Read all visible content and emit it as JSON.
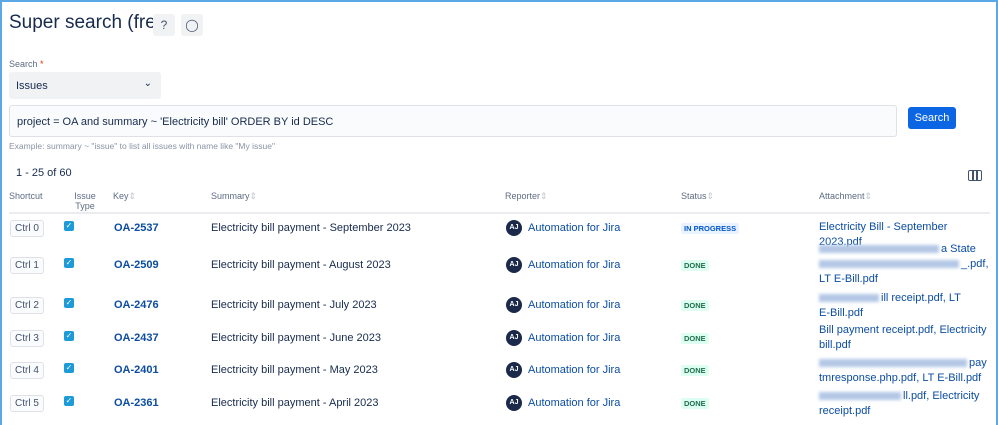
{
  "header": {
    "title": "Super search (free)",
    "help_icon": "?",
    "idea_icon": "lightbulb"
  },
  "search": {
    "label": "Search",
    "required": "*",
    "type": "Issues",
    "query": "project = OA and summary ~ 'Electricity bill' ORDER BY id DESC",
    "button": "Search",
    "hint": "Example: summary ~ \"issue\" to list all issues with name like \"My issue\""
  },
  "results": {
    "count": "1 - 25 of 60"
  },
  "columns": {
    "shortcut": "Shortcut",
    "type": "Issue Type",
    "key": "Key",
    "summary": "Summary",
    "reporter": "Reporter",
    "status": "Status",
    "attachment": "Attachment"
  },
  "rows": [
    {
      "shortcut": "Ctrl 0",
      "key": "OA-2537",
      "summary": "Electricity bill payment - September 2023",
      "initials": "AJ",
      "reporter": "Automation for Jira",
      "status": "IN PROGRESS",
      "attachment": "Electricity Bill - September 2023.pdf"
    },
    {
      "shortcut": "Ctrl 1",
      "key": "OA-2509",
      "summary": "Electricity bill payment - August 2023",
      "initials": "AJ",
      "reporter": "Automation for Jira",
      "status": "DONE",
      "attachment_a": "a State",
      "attachment_b": "_.pdf,",
      "attachment": "LT E-Bill.pdf"
    },
    {
      "shortcut": "Ctrl 2",
      "key": "OA-2476",
      "summary": "Electricity bill payment - July 2023",
      "initials": "AJ",
      "reporter": "Automation for Jira",
      "status": "DONE",
      "attachment_a": "ill receipt.pdf, LT",
      "attachment": "E-Bill.pdf"
    },
    {
      "shortcut": "Ctrl 3",
      "key": "OA-2437",
      "summary": "Electricity bill payment - June 2023",
      "initials": "AJ",
      "reporter": "Automation for Jira",
      "status": "DONE",
      "attachment_a": "Bill payment receipt.pdf, Electricity",
      "attachment": "bill.pdf"
    },
    {
      "shortcut": "Ctrl 4",
      "key": "OA-2401",
      "summary": "Electricity bill payment - May 2023",
      "initials": "AJ",
      "reporter": "Automation for Jira",
      "status": "DONE",
      "attachment_a": "pay",
      "attachment": "tmresponse.php.pdf, LT E-Bill.pdf"
    },
    {
      "shortcut": "Ctrl 5",
      "key": "OA-2361",
      "summary": "Electricity bill payment - April 2023",
      "initials": "AJ",
      "reporter": "Automation for Jira",
      "status": "DONE",
      "attachment_a": "ll.pdf, Electricity",
      "attachment": "receipt.pdf"
    }
  ]
}
